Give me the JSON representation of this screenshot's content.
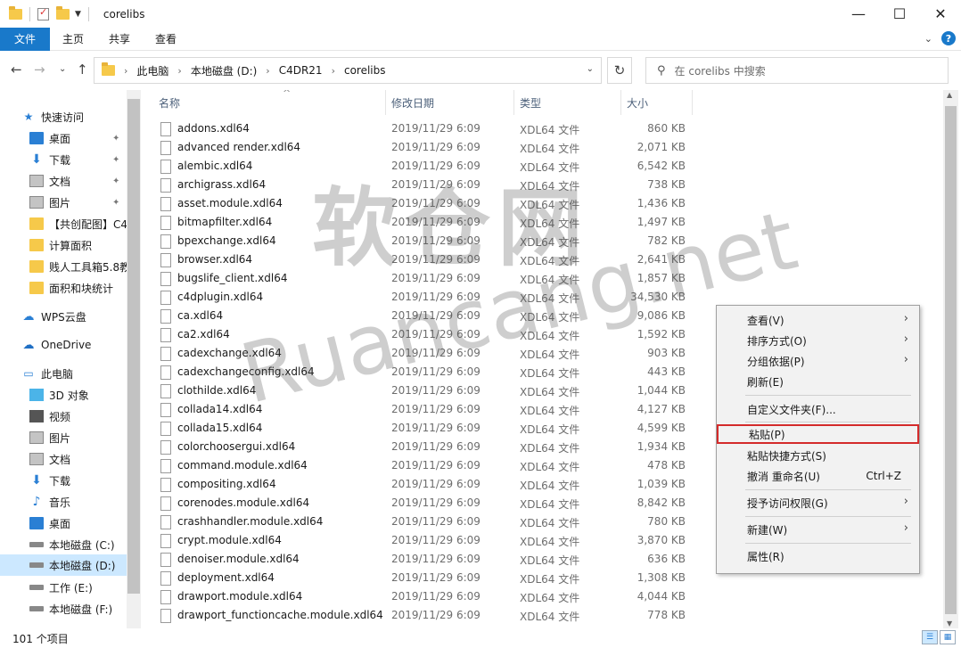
{
  "window": {
    "title": "corelibs"
  },
  "ribbon": {
    "tabs": [
      "文件",
      "主页",
      "共享",
      "查看"
    ]
  },
  "address": {
    "crumbs": [
      "此电脑",
      "本地磁盘 (D:)",
      "C4DR21",
      "corelibs"
    ],
    "search_placeholder": "在 corelibs 中搜索"
  },
  "sidebar": {
    "items": [
      {
        "label": "快速访问",
        "icon": "star-icon"
      },
      {
        "label": "桌面",
        "icon": "desktop-icon",
        "pinned": true
      },
      {
        "label": "下载",
        "icon": "download-icon",
        "pinned": true
      },
      {
        "label": "文档",
        "icon": "document-icon",
        "pinned": true
      },
      {
        "label": "图片",
        "icon": "picture-icon",
        "pinned": true
      },
      {
        "label": "【共创配图】C4",
        "icon": "folder-icon"
      },
      {
        "label": "计算面积",
        "icon": "folder-icon"
      },
      {
        "label": "贱人工具箱5.8教",
        "icon": "folder-icon"
      },
      {
        "label": "面积和块统计",
        "icon": "folder-icon"
      },
      {
        "label": "WPS云盘",
        "icon": "cloud-icon"
      },
      {
        "label": "OneDrive",
        "icon": "onedrive-icon"
      },
      {
        "label": "此电脑",
        "icon": "computer-icon"
      },
      {
        "label": "3D 对象",
        "icon": "3d-objects-icon"
      },
      {
        "label": "视频",
        "icon": "video-icon"
      },
      {
        "label": "图片",
        "icon": "picture-icon"
      },
      {
        "label": "文档",
        "icon": "document-icon"
      },
      {
        "label": "下载",
        "icon": "download-icon"
      },
      {
        "label": "音乐",
        "icon": "music-icon"
      },
      {
        "label": "桌面",
        "icon": "desktop-icon"
      },
      {
        "label": "本地磁盘 (C:)",
        "icon": "drive-icon"
      },
      {
        "label": "本地磁盘 (D:)",
        "icon": "drive-icon",
        "selected": true
      },
      {
        "label": "工作 (E:)",
        "icon": "drive-icon"
      },
      {
        "label": "本地磁盘 (F:)",
        "icon": "drive-icon"
      }
    ]
  },
  "columns": {
    "name": "名称",
    "date": "修改日期",
    "type": "类型",
    "size": "大小"
  },
  "files": [
    {
      "name": "addons.xdl64",
      "date": "2019/11/29 6:09",
      "type": "XDL64 文件",
      "size": "860 KB"
    },
    {
      "name": "advanced render.xdl64",
      "date": "2019/11/29 6:09",
      "type": "XDL64 文件",
      "size": "2,071 KB"
    },
    {
      "name": "alembic.xdl64",
      "date": "2019/11/29 6:09",
      "type": "XDL64 文件",
      "size": "6,542 KB"
    },
    {
      "name": "archigrass.xdl64",
      "date": "2019/11/29 6:09",
      "type": "XDL64 文件",
      "size": "738 KB"
    },
    {
      "name": "asset.module.xdl64",
      "date": "2019/11/29 6:09",
      "type": "XDL64 文件",
      "size": "1,436 KB"
    },
    {
      "name": "bitmapfilter.xdl64",
      "date": "2019/11/29 6:09",
      "type": "XDL64 文件",
      "size": "1,497 KB"
    },
    {
      "name": "bpexchange.xdl64",
      "date": "2019/11/29 6:09",
      "type": "XDL64 文件",
      "size": "782 KB"
    },
    {
      "name": "browser.xdl64",
      "date": "2019/11/29 6:09",
      "type": "XDL64 文件",
      "size": "2,641 KB"
    },
    {
      "name": "bugslife_client.xdl64",
      "date": "2019/11/29 6:09",
      "type": "XDL64 文件",
      "size": "1,857 KB"
    },
    {
      "name": "c4dplugin.xdl64",
      "date": "2019/11/29 6:09",
      "type": "XDL64 文件",
      "size": "34,530 KB"
    },
    {
      "name": "ca.xdl64",
      "date": "2019/11/29 6:09",
      "type": "XDL64 文件",
      "size": "9,086 KB"
    },
    {
      "name": "ca2.xdl64",
      "date": "2019/11/29 6:09",
      "type": "XDL64 文件",
      "size": "1,592 KB"
    },
    {
      "name": "cadexchange.xdl64",
      "date": "2019/11/29 6:09",
      "type": "XDL64 文件",
      "size": "903 KB"
    },
    {
      "name": "cadexchangeconfig.xdl64",
      "date": "2019/11/29 6:09",
      "type": "XDL64 文件",
      "size": "443 KB"
    },
    {
      "name": "clothilde.xdl64",
      "date": "2019/11/29 6:09",
      "type": "XDL64 文件",
      "size": "1,044 KB"
    },
    {
      "name": "collada14.xdl64",
      "date": "2019/11/29 6:09",
      "type": "XDL64 文件",
      "size": "4,127 KB"
    },
    {
      "name": "collada15.xdl64",
      "date": "2019/11/29 6:09",
      "type": "XDL64 文件",
      "size": "4,599 KB"
    },
    {
      "name": "colorchoosergui.xdl64",
      "date": "2019/11/29 6:09",
      "type": "XDL64 文件",
      "size": "1,934 KB"
    },
    {
      "name": "command.module.xdl64",
      "date": "2019/11/29 6:09",
      "type": "XDL64 文件",
      "size": "478 KB"
    },
    {
      "name": "compositing.xdl64",
      "date": "2019/11/29 6:09",
      "type": "XDL64 文件",
      "size": "1,039 KB"
    },
    {
      "name": "corenodes.module.xdl64",
      "date": "2019/11/29 6:09",
      "type": "XDL64 文件",
      "size": "8,842 KB"
    },
    {
      "name": "crashhandler.module.xdl64",
      "date": "2019/11/29 6:09",
      "type": "XDL64 文件",
      "size": "780 KB"
    },
    {
      "name": "crypt.module.xdl64",
      "date": "2019/11/29 6:09",
      "type": "XDL64 文件",
      "size": "3,870 KB"
    },
    {
      "name": "denoiser.module.xdl64",
      "date": "2019/11/29 6:09",
      "type": "XDL64 文件",
      "size": "636 KB"
    },
    {
      "name": "deployment.xdl64",
      "date": "2019/11/29 6:09",
      "type": "XDL64 文件",
      "size": "1,308 KB"
    },
    {
      "name": "drawport.module.xdl64",
      "date": "2019/11/29 6:09",
      "type": "XDL64 文件",
      "size": "4,044 KB"
    },
    {
      "name": "drawport_functioncache.module.xdl64",
      "date": "2019/11/29 6:09",
      "type": "XDL64 文件",
      "size": "778 KB"
    }
  ],
  "status": {
    "count": "101 个项目"
  },
  "context_menu": {
    "items": [
      {
        "label": "查看(V)",
        "submenu": true
      },
      {
        "label": "排序方式(O)",
        "submenu": true
      },
      {
        "label": "分组依据(P)",
        "submenu": true
      },
      {
        "label": "刷新(E)"
      },
      {
        "label": "自定义文件夹(F)..."
      },
      {
        "label": "粘贴(P)",
        "highlighted": true
      },
      {
        "label": "粘贴快捷方式(S)"
      },
      {
        "label": "撤消 重命名(U)",
        "shortcut": "Ctrl+Z"
      },
      {
        "label": "授予访问权限(G)",
        "submenu": true
      },
      {
        "label": "新建(W)",
        "submenu": true
      },
      {
        "label": "属性(R)"
      }
    ]
  },
  "watermark": {
    "line1": "软仓网",
    "line2": "Ruancang.net"
  },
  "colors": {
    "accent": "#1979ca",
    "selection": "#cce8ff",
    "highlight_box": "#d42b2b"
  }
}
